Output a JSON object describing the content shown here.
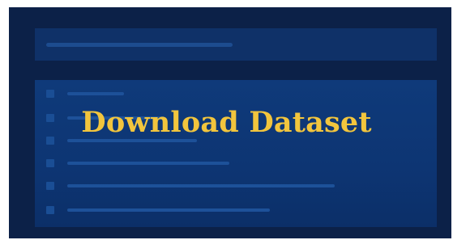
{
  "banner": {
    "title": "Download Dataset"
  },
  "colors": {
    "background": "#0c2148",
    "panel": "#0f3a7a",
    "title": "#f2c53d"
  }
}
